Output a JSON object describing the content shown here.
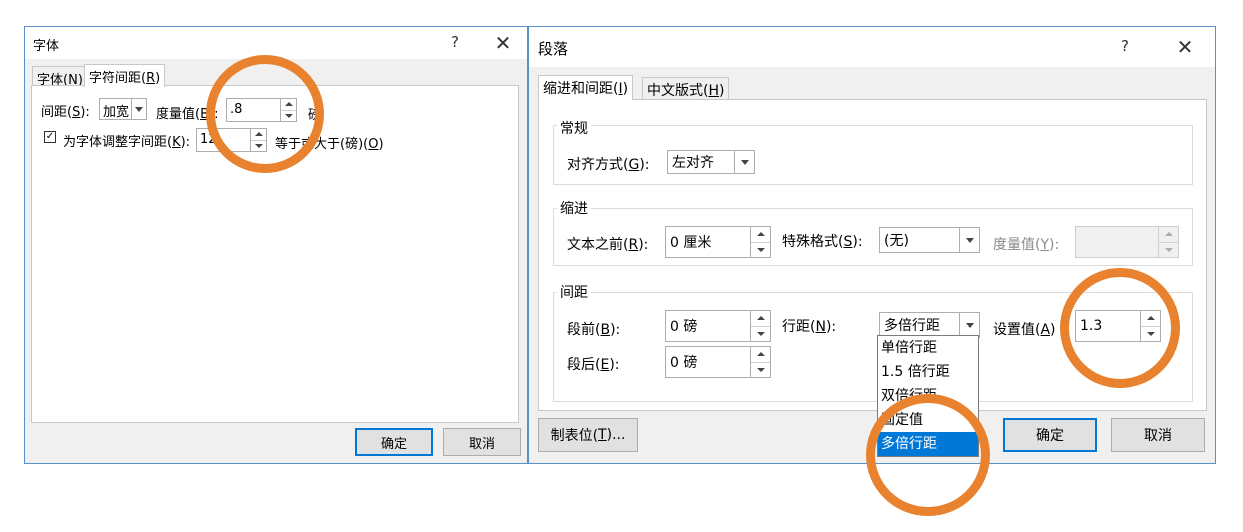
{
  "font_dialog": {
    "title": "字体",
    "help": "?",
    "close": "✕",
    "tabs": [
      {
        "label": "字体(",
        "key": "N",
        "suffix": ")"
      },
      {
        "label": "字符间距(",
        "key": "R",
        "suffix": ")"
      }
    ],
    "spacing": {
      "label": "间距(",
      "key": "S",
      "suffix": "):",
      "value": "加宽",
      "measure_label": "度量值(",
      "measure_key": "B",
      "measure_suffix": "):",
      "measure_value": ".8",
      "unit": "磅"
    },
    "kerning": {
      "checked": true,
      "check_glyph": "✓",
      "label": "为字体调整字间距(",
      "key": "K",
      "suffix": "):",
      "value": "12",
      "after_label": "等于或大于(磅)(",
      "after_key": "O",
      "after_suffix": ")"
    },
    "ok": "确定",
    "cancel": "取消"
  },
  "para_dialog": {
    "title": "段落",
    "help": "?",
    "close": "✕",
    "tabs": [
      {
        "label": "缩进和间距(",
        "key": "I",
        "suffix": ")"
      },
      {
        "label": "中文版式(",
        "key": "H",
        "suffix": ")"
      }
    ],
    "general": {
      "title": "常规",
      "align_label": "对齐方式(",
      "align_key": "G",
      "align_suffix": "):",
      "align_value": "左对齐"
    },
    "indent": {
      "title": "缩进",
      "before_label": "文本之前(",
      "before_key": "R",
      "before_suffix": "):",
      "before_value": "0 厘米",
      "special_label": "特殊格式(",
      "special_key": "S",
      "special_suffix": "):",
      "special_value": "(无)",
      "measure_label": "度量值(",
      "measure_key": "Y",
      "measure_suffix": "):",
      "measure_value": ""
    },
    "spacing": {
      "title": "间距",
      "before_label": "段前(",
      "before_key": "B",
      "before_suffix": "):",
      "before_value": "0 磅",
      "after_label": "段后(",
      "after_key": "E",
      "after_suffix": "):",
      "after_value": "0 磅",
      "line_label": "行距(",
      "line_key": "N",
      "line_suffix": "):",
      "line_value": "多倍行距",
      "setting_label": "设置值(",
      "setting_key": "A",
      "setting_suffix": ")",
      "setting_value": "1.3",
      "line_options": [
        "单倍行距",
        "1.5 倍行距",
        "双倍行距",
        "固定值",
        "多倍行距"
      ],
      "selected_index": 4
    },
    "tabs_button": {
      "label": "制表位(",
      "key": "T",
      "suffix": ")..."
    },
    "ok": "确定",
    "cancel": "取消"
  },
  "colors": {
    "annotation_ring": "#e8822e",
    "selection": "#0078d7",
    "dialog_border": "#5b8fc9"
  }
}
